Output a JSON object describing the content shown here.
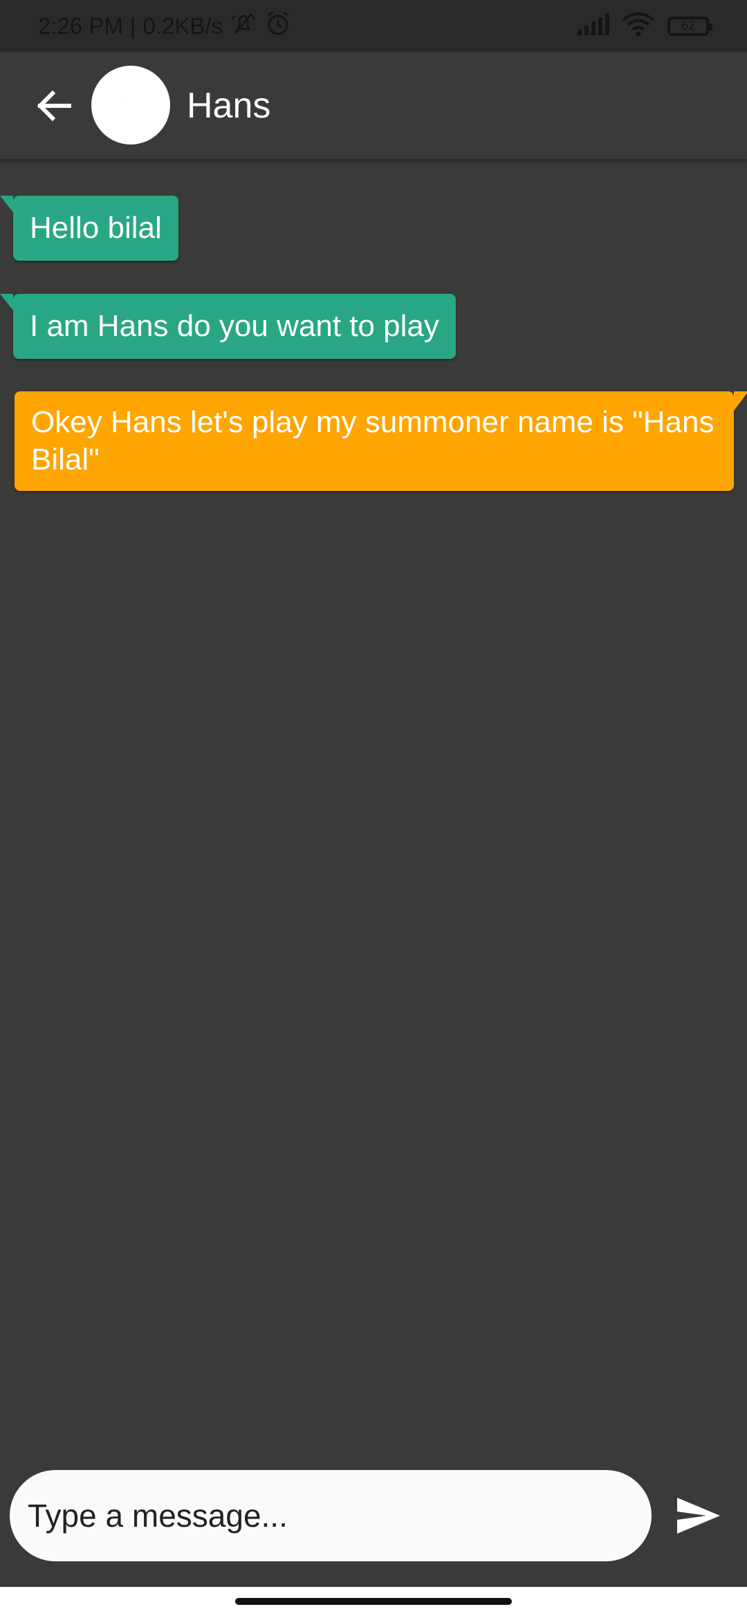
{
  "status_bar": {
    "time": "2:26 PM",
    "separator": "|",
    "network_speed": "0.2KB/s",
    "battery_level": "62",
    "icons": [
      "mute-notification-icon",
      "alarm-icon",
      "signal-icon",
      "wifi-icon",
      "battery-icon"
    ]
  },
  "header": {
    "back_icon": "arrow-left-icon",
    "avatar_letter": "H",
    "title": "Hans"
  },
  "messages": [
    {
      "direction": "incoming",
      "text": "Hello bilal"
    },
    {
      "direction": "incoming",
      "text": "I am Hans do you want to play"
    },
    {
      "direction": "outgoing",
      "text": "Okey Hans let's play my summoner name is \"Hans Bilal\""
    }
  ],
  "composer": {
    "placeholder": "Type a message...",
    "value": "",
    "send_icon": "send-icon"
  },
  "colors": {
    "background": "#3a3b39",
    "incoming_bubble": "#29a784",
    "outgoing_bubble": "#ffa502",
    "input_background": "#fafafa"
  }
}
